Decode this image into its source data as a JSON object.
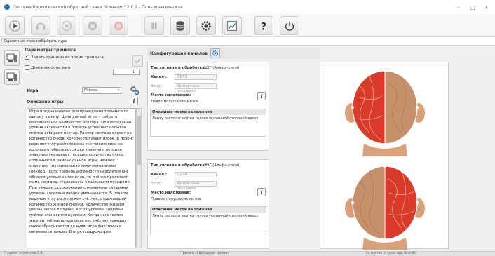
{
  "window": {
    "title": "Система биологической обратной связи \"Кинезис\" 2.0.2 - Пользовательская",
    "controls": [
      "–",
      "□",
      "✕"
    ]
  },
  "toolbar": {
    "buttons": [
      {
        "name": "play-icon"
      },
      {
        "name": "headset-icon"
      },
      {
        "name": "target-icon"
      },
      {
        "name": "stop-icon"
      },
      {
        "name": "record-icon"
      },
      {
        "name": "pause-icon"
      },
      {
        "name": "database-icon"
      },
      {
        "name": "gear-icon"
      },
      {
        "name": "chart-icon"
      },
      {
        "name": "help-icon"
      },
      {
        "name": "power-icon"
      }
    ],
    "help_glyph": "?"
  },
  "tabs": [
    {
      "label": "Одиночный тренинг",
      "active": true
    },
    {
      "label": "Выбрать курс",
      "active": false
    }
  ],
  "params": {
    "title": "Параметры тренинга",
    "set_bounds_label": "Задать границы во время тренинга",
    "set_bounds_checked": true,
    "duration_label": "Длительность, мин.",
    "duration_checked": false,
    "duration_value": "1"
  },
  "game": {
    "label": "Игра",
    "selected": "Пчёлка",
    "arrow": "▾",
    "description_label": "Описание игры",
    "info_glyph": "i",
    "description": "Игра предназначена для проведения тренинга по одному каналу. Цель данной игры – собрать максимальное количество нектара. При попадании уровня активности в область успешных попыток пчёлка собирает нектар. Размер нектара влияет на количество очков, которое получает игрок. В левом верхнем углу расположены счетчики очков, на которых отображаются два значения: верхнее значение указывает текущее количество очков, собранного в рамках данной игры, нижнее значение - максимальное количество очков (рекорд). Если уровень активности находится вне области успешных попыток, то пчёлка пролетает мимо нектара, сталкиваясь с мыльными пузырями. При каждом столкновении с мыльными пузырями уровень здоровья пчёлки уменьшается. В правом верхнем углу расположен счётчик, отражающий количество жизней пчёлки. Количество жизней уменьшается в случае, когда уровень здоровья пчёлки становится нулевым. Когда количество жизней пчёлки исчерпывается, счётчик текущих очков сбрасывается до нуля, игра фактически начинается заново. В игре предусмотрен"
  },
  "config": {
    "title": "Конфигурация каналов",
    "channels": [
      {
        "signal_label": "Тип сигнала и обработка :",
        "signal_value": "ЭЭГ (Альфа-ритм)",
        "channel_label": "Канал :",
        "channel_value": "O1-T3",
        "input_label": "Вход :",
        "input_value": "Контактные площадки",
        "place_label": "Место наложения:",
        "place_value": "Левое полушарие мозга",
        "place_desc_label": "Описание места наложения",
        "place_desc": "Ленту располагают на голове указанной стороной вверх"
      },
      {
        "signal_label": "Тип сигнала и обработка :",
        "signal_value": "ЭЭГ (Альфа-ритм)",
        "channel_label": "Канал :",
        "channel_value": "O2-T4",
        "input_label": "Вход :",
        "input_value": "Контактные площадки",
        "place_label": "Место наложения:",
        "place_value": "Правое полушарие мозга",
        "place_desc_label": "Описание места наложения",
        "place_desc": "Ленту располагают на голове указанной стороной вверх"
      }
    ]
  },
  "heads": [
    {
      "highlight": "left"
    },
    {
      "highlight": "right"
    }
  ],
  "colors": {
    "accent": "#2a6fb0",
    "head_highlight": "#d83b2a",
    "skin": "#d9a07c"
  },
  "status": {
    "left": "Пациент: Алексеев С.В.",
    "middle": "Тренинг: Свободный тренинг",
    "right": "Состояние устройства: BrainBit"
  }
}
